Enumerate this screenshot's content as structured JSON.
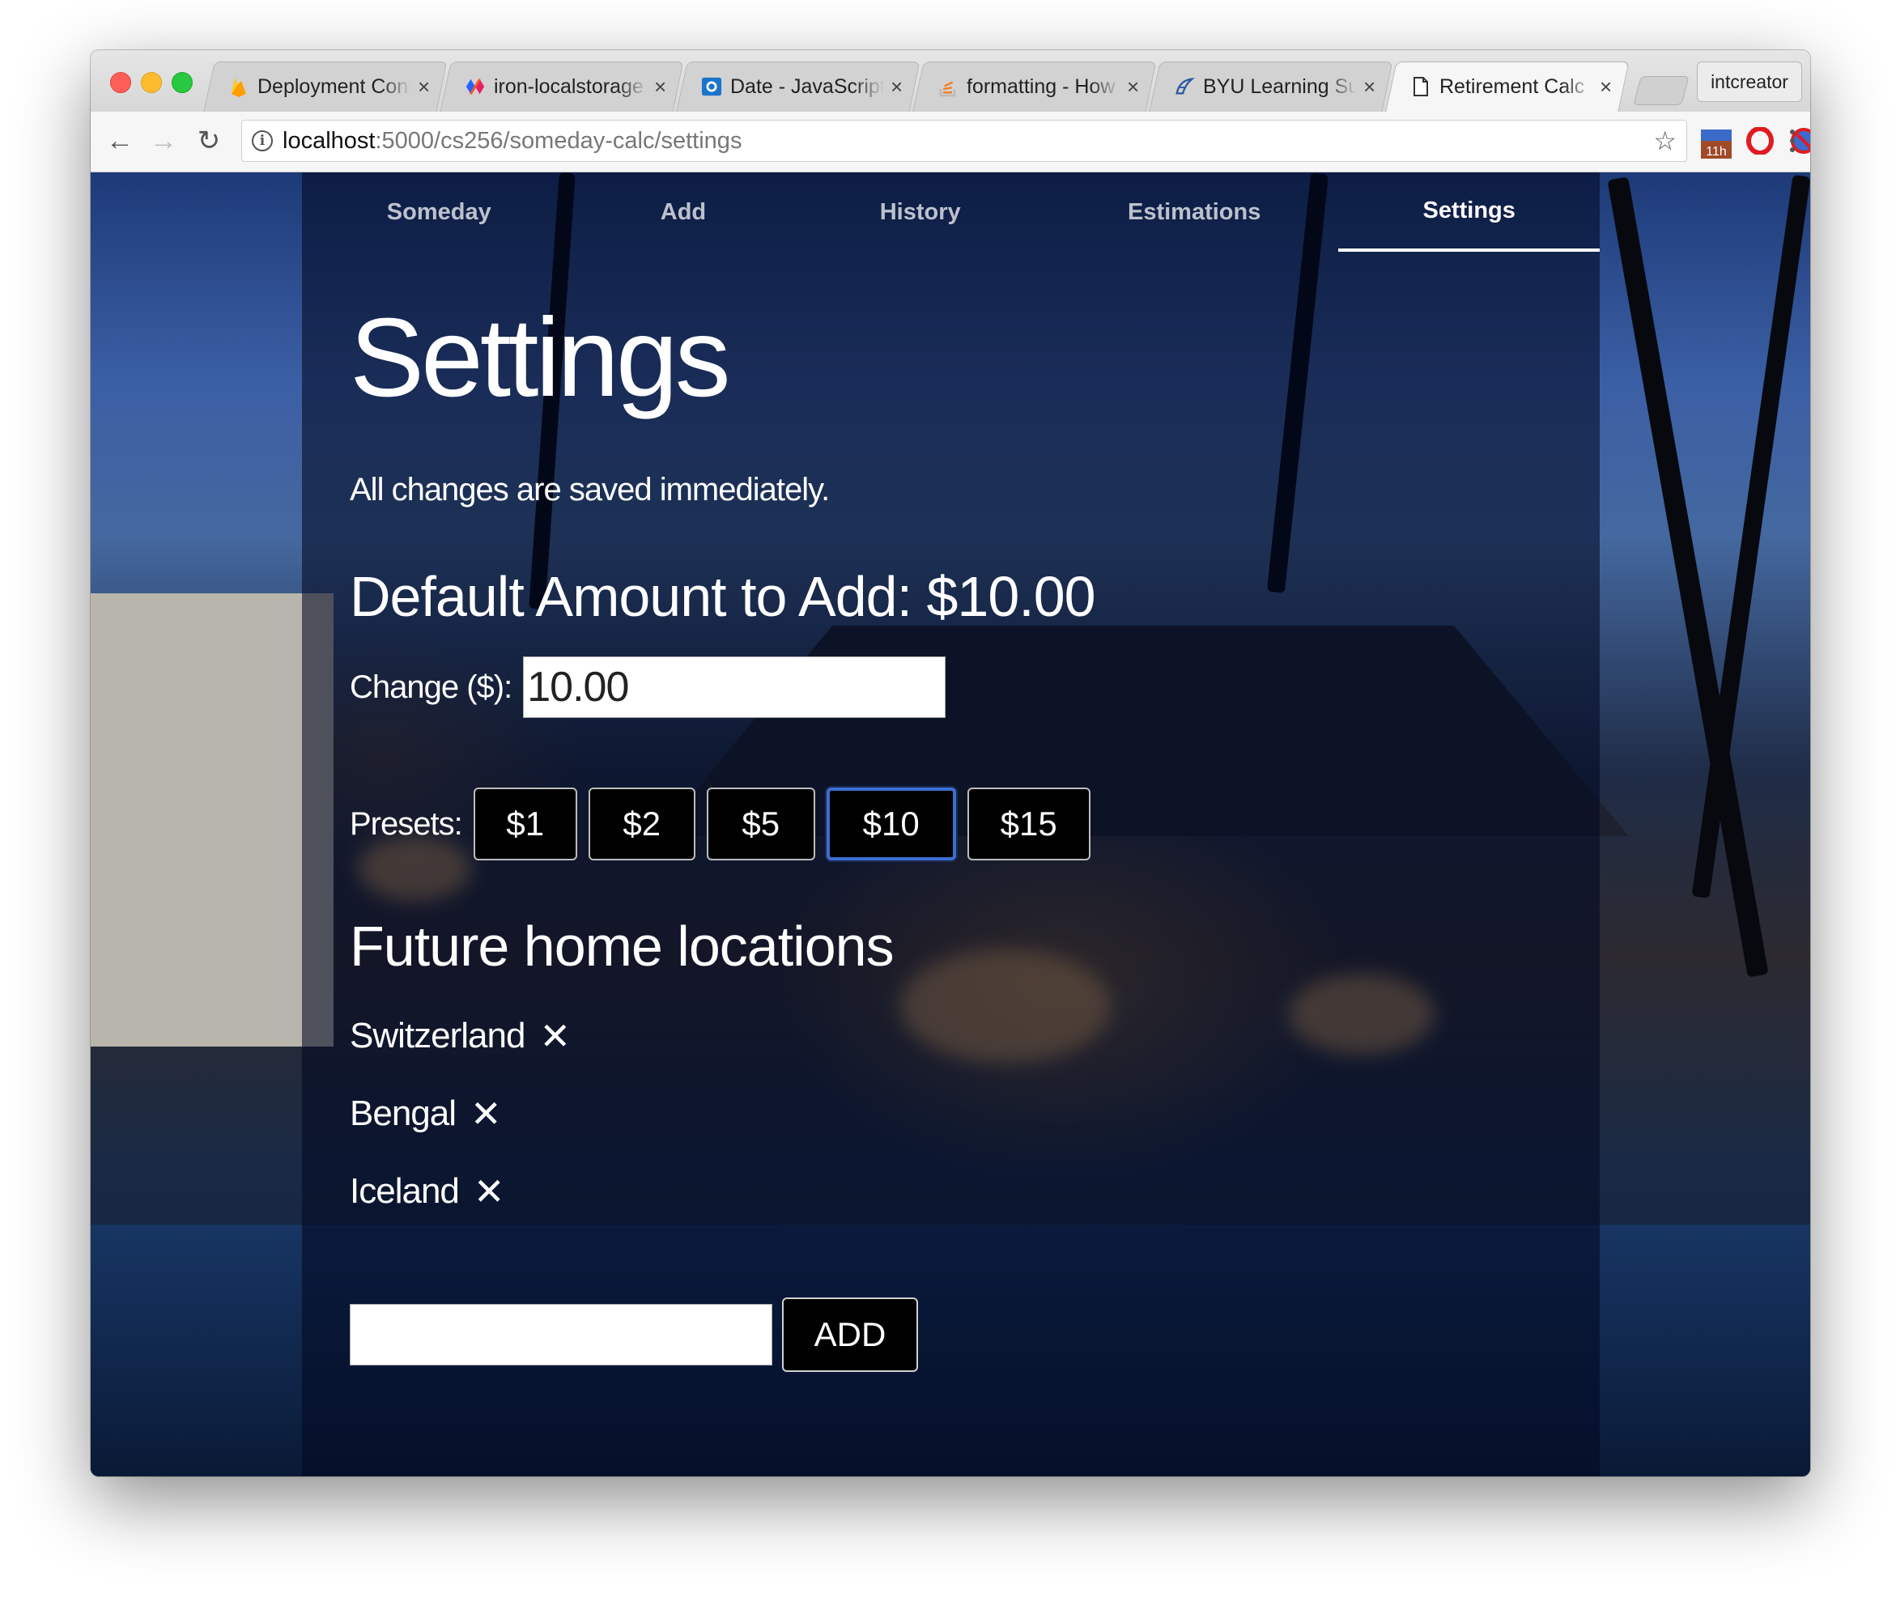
{
  "browser": {
    "tabs": [
      {
        "title": "Deployment Console",
        "favicon": "firebase-icon",
        "active": false
      },
      {
        "title": "iron-localstorage",
        "favicon": "polymer-icon",
        "active": false
      },
      {
        "title": "Date - JavaScript",
        "favicon": "mdn-icon",
        "active": false
      },
      {
        "title": "formatting - How",
        "favicon": "stackoverflow-icon",
        "active": false
      },
      {
        "title": "BYU Learning Suite",
        "favicon": "byu-icon",
        "active": false
      },
      {
        "title": "Retirement Calc",
        "favicon": "page-icon",
        "active": true
      }
    ],
    "profile_name": "intcreator",
    "url_host": "localhost",
    "url_rest": ":5000/cs256/someday-calc/settings",
    "extension_badge": "11h"
  },
  "nav": {
    "items": [
      {
        "label": "Someday",
        "active": false
      },
      {
        "label": "Add",
        "active": false
      },
      {
        "label": "History",
        "active": false
      },
      {
        "label": "Estimations",
        "active": false
      },
      {
        "label": "Settings",
        "active": true
      }
    ]
  },
  "page": {
    "title": "Settings",
    "subtitle": "All changes are saved immediately.",
    "default_amount_heading": "Default Amount to Add: $10.00",
    "change_label": "Change ($):",
    "change_value": "10.00",
    "presets_label": "Presets:",
    "presets": [
      {
        "label": "$1",
        "selected": false
      },
      {
        "label": "$2",
        "selected": false
      },
      {
        "label": "$5",
        "selected": false
      },
      {
        "label": "$10",
        "selected": true
      },
      {
        "label": "$15",
        "selected": false
      }
    ],
    "locations_heading": "Future home locations",
    "locations": [
      "Switzerland",
      "Bengal",
      "Iceland"
    ],
    "remove_glyph": "✕",
    "new_location_value": "",
    "add_label": "ADD"
  },
  "colors": {
    "panel_overlay": "#020820",
    "selected_preset_border": "#3b6fd1",
    "button_bg": "#000000"
  }
}
